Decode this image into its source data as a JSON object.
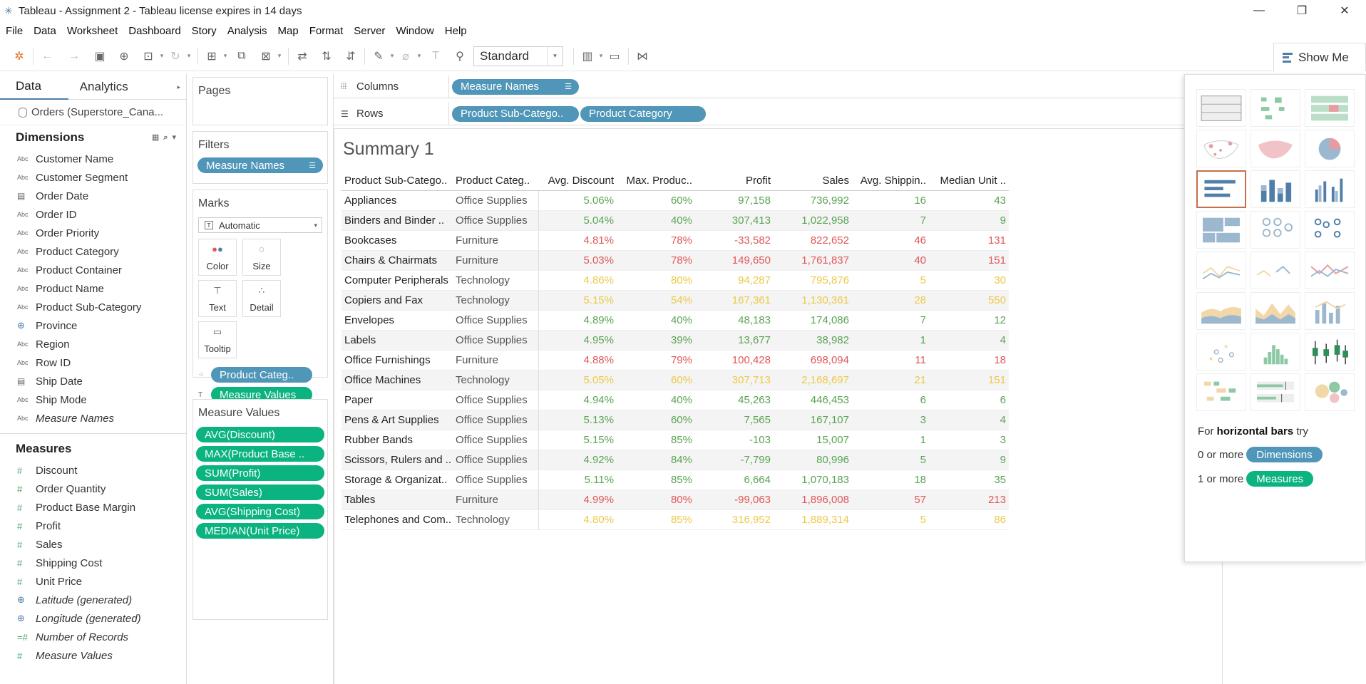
{
  "window": {
    "title": "Tableau - Assignment 2 - Tableau license expires in 14 days",
    "controls": {
      "minimize": "—",
      "restore": "❐",
      "close": "✕"
    }
  },
  "menu": [
    "File",
    "Data",
    "Worksheet",
    "Dashboard",
    "Story",
    "Analysis",
    "Map",
    "Format",
    "Server",
    "Window",
    "Help"
  ],
  "toolbar": {
    "fit_select": "Standard",
    "show_me_label": "Show Me"
  },
  "datapane": {
    "tabs": {
      "data": "Data",
      "analytics": "Analytics"
    },
    "datasource": "Orders (Superstore_Cana...",
    "dimensions_label": "Dimensions",
    "dimensions": [
      {
        "type": "Abc",
        "name": "Customer Name"
      },
      {
        "type": "Abc",
        "name": "Customer Segment"
      },
      {
        "type": "cal",
        "name": "Order Date"
      },
      {
        "type": "Abc",
        "name": "Order ID"
      },
      {
        "type": "Abc",
        "name": "Order Priority"
      },
      {
        "type": "Abc",
        "name": "Product Category"
      },
      {
        "type": "Abc",
        "name": "Product Container"
      },
      {
        "type": "Abc",
        "name": "Product Name"
      },
      {
        "type": "Abc",
        "name": "Product Sub-Category"
      },
      {
        "type": "globe",
        "name": "Province"
      },
      {
        "type": "Abc",
        "name": "Region"
      },
      {
        "type": "Abc",
        "name": "Row ID"
      },
      {
        "type": "cal",
        "name": "Ship Date"
      },
      {
        "type": "Abc",
        "name": "Ship Mode"
      },
      {
        "type": "Abc",
        "name": "Measure Names"
      }
    ],
    "measures_label": "Measures",
    "measures": [
      {
        "type": "hash",
        "name": "Discount"
      },
      {
        "type": "hash",
        "name": "Order Quantity"
      },
      {
        "type": "hash",
        "name": "Product Base Margin"
      },
      {
        "type": "hash",
        "name": "Profit"
      },
      {
        "type": "hash",
        "name": "Sales"
      },
      {
        "type": "hash",
        "name": "Shipping Cost"
      },
      {
        "type": "hash",
        "name": "Unit Price"
      },
      {
        "type": "globe",
        "name": "Latitude (generated)"
      },
      {
        "type": "globe",
        "name": "Longitude (generated)"
      },
      {
        "type": "hash",
        "name": "Number of Records"
      },
      {
        "type": "hash",
        "name": "Measure Values"
      }
    ]
  },
  "cards": {
    "pages": "Pages",
    "filters": "Filters",
    "filter_pill": "Measure Names",
    "marks": "Marks",
    "marks_type": "Automatic",
    "mark_buttons": [
      "Color",
      "Size",
      "Text",
      "Detail",
      "Tooltip"
    ],
    "marks_pills": [
      "Product Categ..",
      "Measure Values"
    ],
    "measure_values_title": "Measure Values",
    "measure_values": [
      "AVG(Discount)",
      "MAX(Product Base ..",
      "SUM(Profit)",
      "SUM(Sales)",
      "AVG(Shipping Cost)",
      "MEDIAN(Unit Price)"
    ]
  },
  "shelves": {
    "columns_label": "Columns",
    "columns_pill": "Measure Names",
    "rows_label": "Rows",
    "rows_pills": [
      "Product Sub-Catego..",
      "Product Category"
    ]
  },
  "view": {
    "title": "Summary 1",
    "headers": [
      "Product Sub-Catego..",
      "Product Categ..",
      "Avg. Discount",
      "Max. Produc..",
      "Profit",
      "Sales",
      "Avg. Shippin..",
      "Median Unit .."
    ],
    "category_colors": {
      "Office Supplies": "#5aa454",
      "Furniture": "#e15759",
      "Technology": "#edc948"
    },
    "rows": [
      [
        "Appliances",
        "Office Supplies",
        "5.06%",
        "60%",
        "97,158",
        "736,992",
        "16",
        "43"
      ],
      [
        "Binders and Binder ..",
        "Office Supplies",
        "5.04%",
        "40%",
        "307,413",
        "1,022,958",
        "7",
        "9"
      ],
      [
        "Bookcases",
        "Furniture",
        "4.81%",
        "78%",
        "-33,582",
        "822,652",
        "46",
        "131"
      ],
      [
        "Chairs & Chairmats",
        "Furniture",
        "5.03%",
        "78%",
        "149,650",
        "1,761,837",
        "40",
        "151"
      ],
      [
        "Computer Peripherals",
        "Technology",
        "4.86%",
        "80%",
        "94,287",
        "795,876",
        "5",
        "30"
      ],
      [
        "Copiers and Fax",
        "Technology",
        "5.15%",
        "54%",
        "167,361",
        "1,130,361",
        "28",
        "550"
      ],
      [
        "Envelopes",
        "Office Supplies",
        "4.89%",
        "40%",
        "48,183",
        "174,086",
        "7",
        "12"
      ],
      [
        "Labels",
        "Office Supplies",
        "4.95%",
        "39%",
        "13,677",
        "38,982",
        "1",
        "4"
      ],
      [
        "Office Furnishings",
        "Furniture",
        "4.88%",
        "79%",
        "100,428",
        "698,094",
        "11",
        "18"
      ],
      [
        "Office Machines",
        "Technology",
        "5.05%",
        "60%",
        "307,713",
        "2,168,697",
        "21",
        "151"
      ],
      [
        "Paper",
        "Office Supplies",
        "4.94%",
        "40%",
        "45,263",
        "446,453",
        "6",
        "6"
      ],
      [
        "Pens & Art Supplies",
        "Office Supplies",
        "5.13%",
        "60%",
        "7,565",
        "167,107",
        "3",
        "4"
      ],
      [
        "Rubber Bands",
        "Office Supplies",
        "5.15%",
        "85%",
        "-103",
        "15,007",
        "1",
        "3"
      ],
      [
        "Scissors, Rulers and ..",
        "Office Supplies",
        "4.92%",
        "84%",
        "-7,799",
        "80,996",
        "5",
        "9"
      ],
      [
        "Storage & Organizat..",
        "Office Supplies",
        "5.11%",
        "85%",
        "6,664",
        "1,070,183",
        "18",
        "35"
      ],
      [
        "Tables",
        "Furniture",
        "4.99%",
        "80%",
        "-99,063",
        "1,896,008",
        "57",
        "213"
      ],
      [
        "Telephones and Com..",
        "Technology",
        "4.80%",
        "85%",
        "316,952",
        "1,889,314",
        "5",
        "86"
      ]
    ]
  },
  "showme": {
    "hint_prefix": "For",
    "hint_bold": "horizontal bars",
    "hint_suffix": "try",
    "req1_prefix": "0 or more",
    "req1_pill": "Dimensions",
    "req2_prefix": "1 or more",
    "req2_pill": "Measures",
    "chart_types": [
      "text-table-icon",
      "heat-map-icon",
      "highlight-table-icon",
      "symbol-map-icon",
      "filled-map-icon",
      "pie-chart-icon",
      "horizontal-bars-icon",
      "stacked-bars-icon",
      "side-by-side-bars-icon",
      "treemap-icon",
      "circle-view-icon",
      "side-by-side-circles-icon",
      "continuous-lines-icon",
      "discrete-lines-icon",
      "dual-lines-icon",
      "area-continuous-icon",
      "area-discrete-icon",
      "dual-combination-icon",
      "scatter-plot-icon",
      "histogram-icon",
      "box-whisker-icon",
      "gantt-icon",
      "bullet-graph-icon",
      "packed-bubbles-icon"
    ]
  }
}
